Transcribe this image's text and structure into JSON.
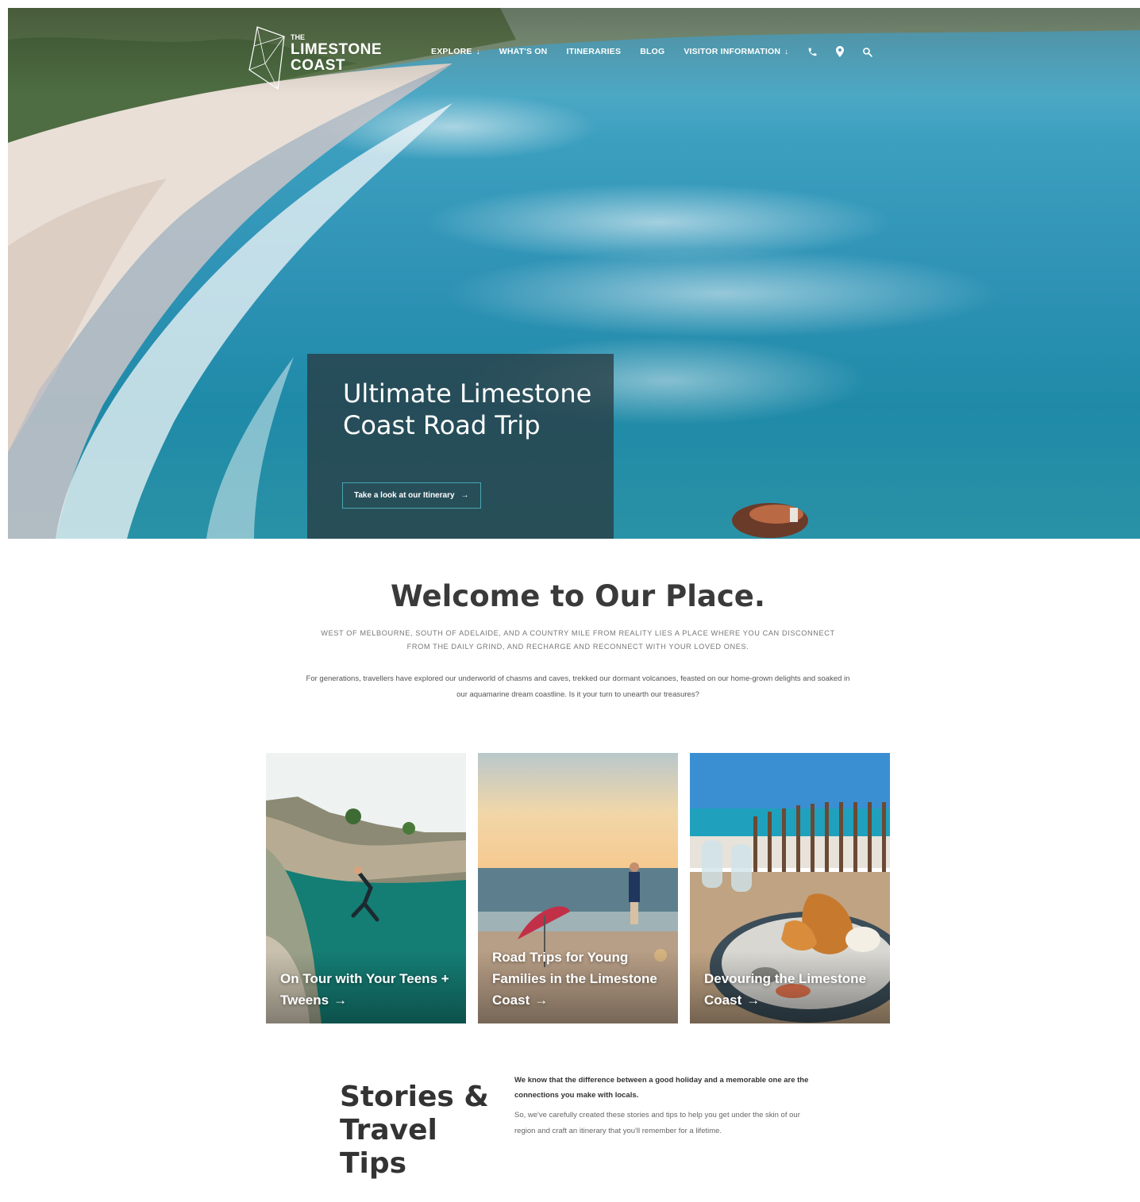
{
  "header": {
    "logo": {
      "the": "THE",
      "line1": "LIMESTONE",
      "line2": "COAST"
    },
    "nav": [
      {
        "label": "EXPLORE",
        "chevron": "↓"
      },
      {
        "label": "WHAT'S ON"
      },
      {
        "label": "ITINERARIES"
      },
      {
        "label": "BLOG"
      },
      {
        "label": "VISITOR INFORMATION",
        "chevron": "↓"
      }
    ],
    "icons": [
      "phone-icon",
      "map-pin-icon",
      "search-icon"
    ]
  },
  "hero": {
    "title": "Ultimate Limestone Coast Road Trip",
    "cta": "Take a look at our Itinerary",
    "cta_arrow": "→"
  },
  "welcome": {
    "title_light": "Welcome to ",
    "title_bold": "Our Place.",
    "subtitle": "West of Melbourne, south of Adelaide, and a country mile from reality lies a place where you can disconnect from the daily grind, and recharge and reconnect with your loved ones.",
    "body": "For generations, travellers have explored our underworld of chasms and caves, trekked our dormant volcanoes, feasted on our home-grown delights and soaked in our aquamarine dream coastline. Is it your turn to unearth our treasures?"
  },
  "cards": [
    {
      "label": "On Tour with Your Teens + Tweens",
      "arrow": "→"
    },
    {
      "label": "Road Trips for Young Families in the Limestone Coast",
      "arrow": "→"
    },
    {
      "label": "Devouring the Limestone Coast",
      "arrow": "→"
    }
  ],
  "stories": {
    "title_bold": "Stories",
    "title_amp": " &",
    "title_line2": "Travel Tips",
    "intro": "We know that the difference between a good holiday and a memorable one are the connections you make with locals.",
    "body": "So, we've carefully created these stories and tips to help you get under the skin of our region and craft an itinerary that you'll remember for a lifetime."
  },
  "colors": {
    "accent": "#4aa7b3",
    "hero_card_bg": "#283c42",
    "text_dark": "#333333"
  }
}
